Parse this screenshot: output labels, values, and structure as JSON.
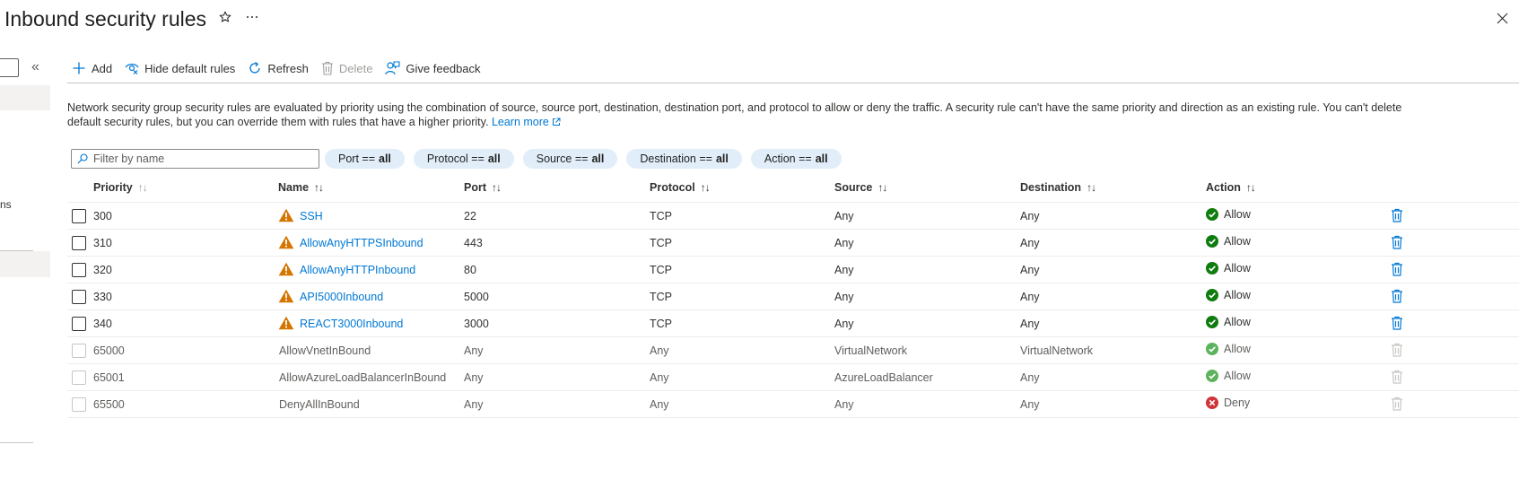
{
  "header": {
    "title": "Inbound security rules",
    "favorite_icon": "star-icon",
    "more_icon": "ellipsis-icon",
    "close_icon": "close-icon"
  },
  "left_panel": {
    "partial_text": "ns",
    "collapse_glyph": "«"
  },
  "toolbar": {
    "add": "Add",
    "hide_default": "Hide default rules",
    "refresh": "Refresh",
    "delete": "Delete",
    "feedback": "Give feedback"
  },
  "description": {
    "text": "Network security group security rules are evaluated by priority using the combination of source, source port, destination, destination port, and protocol to allow or deny the traffic. A security rule can't have the same priority and direction as an existing rule. You can't delete default security rules, but you can override them with rules that have a higher priority.",
    "learn_more": "Learn more"
  },
  "filter": {
    "placeholder": "Filter by name",
    "pills": [
      {
        "label": "Port ==",
        "value": "all"
      },
      {
        "label": "Protocol ==",
        "value": "all"
      },
      {
        "label": "Source ==",
        "value": "all"
      },
      {
        "label": "Destination ==",
        "value": "all"
      },
      {
        "label": "Action ==",
        "value": "all"
      }
    ]
  },
  "table": {
    "columns": [
      "Priority",
      "Name",
      "Port",
      "Protocol",
      "Source",
      "Destination",
      "Action"
    ],
    "sort_glyph": "↑↓",
    "rows": [
      {
        "priority": "300",
        "name": "SSH",
        "port": "22",
        "protocol": "TCP",
        "source": "Any",
        "destination": "Any",
        "action": "Allow"
      },
      {
        "priority": "310",
        "name": "AllowAnyHTTPSInbound",
        "port": "443",
        "protocol": "TCP",
        "source": "Any",
        "destination": "Any",
        "action": "Allow"
      },
      {
        "priority": "320",
        "name": "AllowAnyHTTPInbound",
        "port": "80",
        "protocol": "TCP",
        "source": "Any",
        "destination": "Any",
        "action": "Allow"
      },
      {
        "priority": "330",
        "name": "API5000Inbound",
        "port": "5000",
        "protocol": "TCP",
        "source": "Any",
        "destination": "Any",
        "action": "Allow"
      },
      {
        "priority": "340",
        "name": "REACT3000Inbound",
        "port": "3000",
        "protocol": "TCP",
        "source": "Any",
        "destination": "Any",
        "action": "Allow"
      },
      {
        "priority": "65000",
        "name": "AllowVnetInBound",
        "port": "Any",
        "protocol": "Any",
        "source": "VirtualNetwork",
        "destination": "VirtualNetwork",
        "action": "Allow"
      },
      {
        "priority": "65001",
        "name": "AllowAzureLoadBalancerInBound",
        "port": "Any",
        "protocol": "Any",
        "source": "AzureLoadBalancer",
        "destination": "Any",
        "action": "Allow"
      },
      {
        "priority": "65500",
        "name": "DenyAllInBound",
        "port": "Any",
        "protocol": "Any",
        "source": "Any",
        "destination": "Any",
        "action": "Deny"
      }
    ]
  },
  "colors": {
    "accent": "#0078d4",
    "warning": "#d47500",
    "allow": "#107c10",
    "allow_default": "#5db35d",
    "deny": "#d13438",
    "pill_bg": "#e1eef9"
  }
}
